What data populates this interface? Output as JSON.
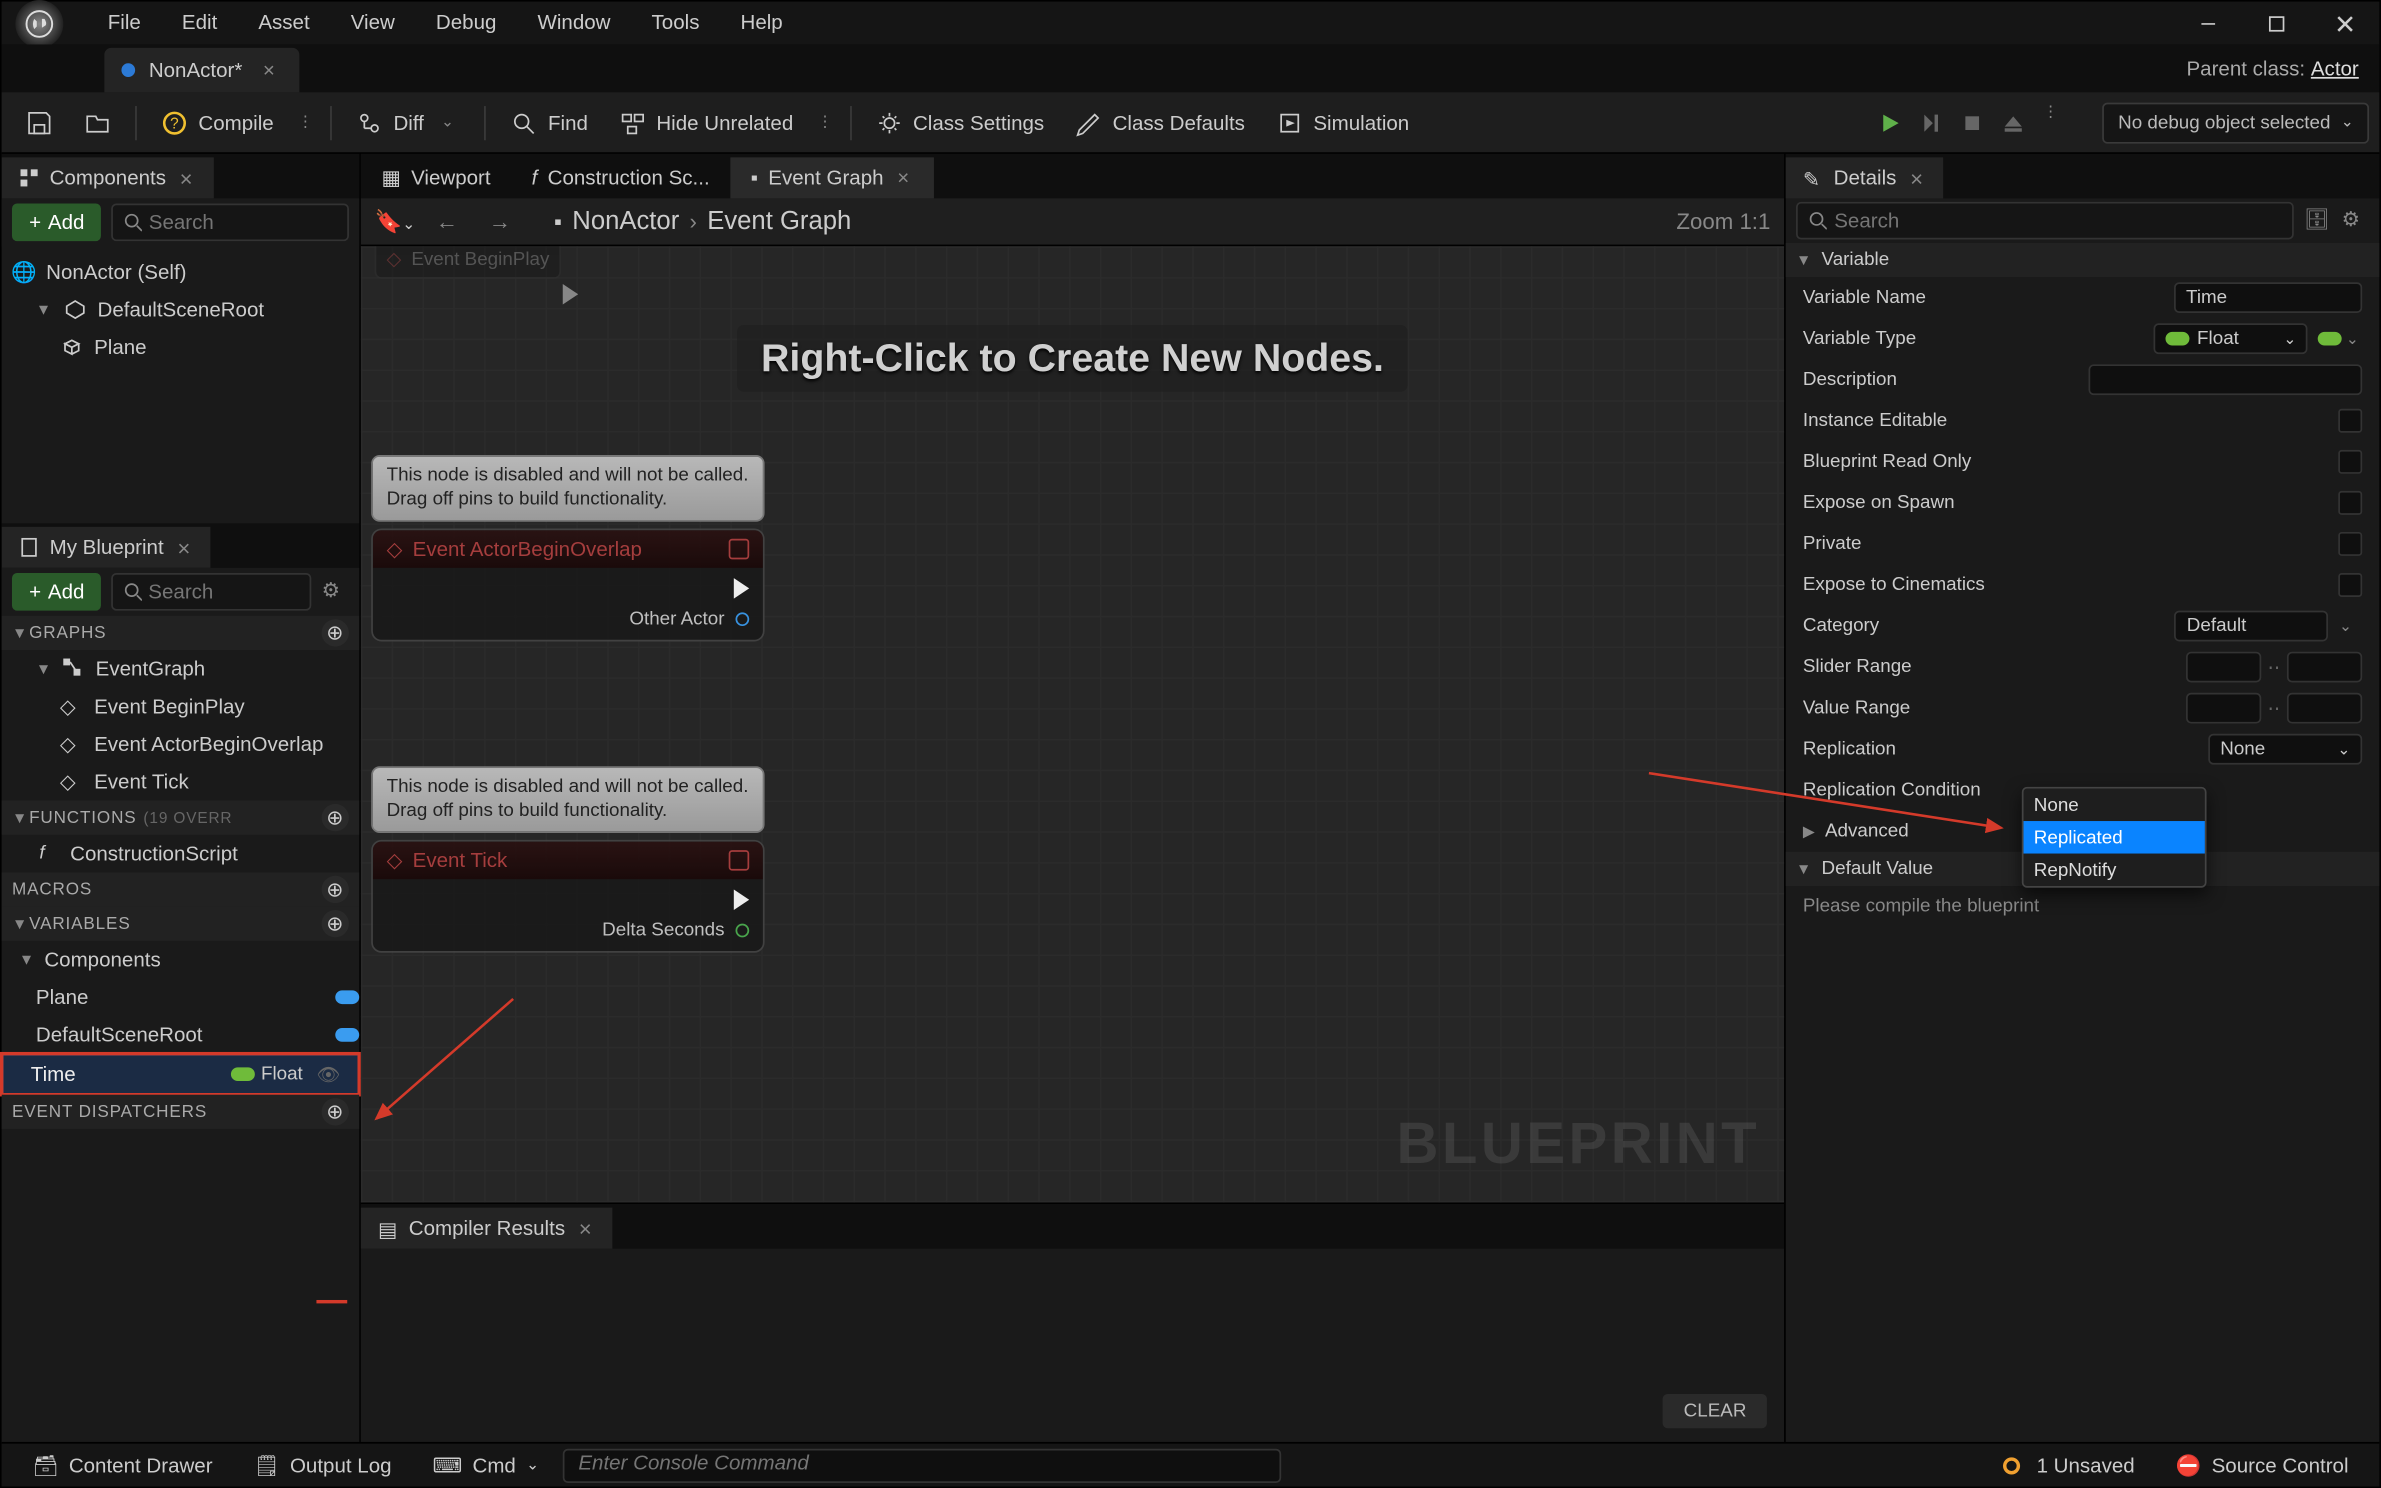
{
  "menu": [
    "File",
    "Edit",
    "Asset",
    "View",
    "Debug",
    "Window",
    "Tools",
    "Help"
  ],
  "docTab": {
    "title": "NonActor*"
  },
  "parentClass": {
    "label": "Parent class:",
    "value": "Actor"
  },
  "toolbar": {
    "compile": "Compile",
    "diff": "Diff",
    "find": "Find",
    "hideUnrelated": "Hide Unrelated",
    "classSettings": "Class Settings",
    "classDefaults": "Class Defaults",
    "simulation": "Simulation",
    "debugCombo": "No debug object selected"
  },
  "componentsPanel": {
    "tab": "Components",
    "add": "Add",
    "searchPlaceholder": "Search",
    "root": "NonActor (Self)",
    "sceneRoot": "DefaultSceneRoot",
    "plane": "Plane"
  },
  "myBlueprint": {
    "tab": "My Blueprint",
    "add": "Add",
    "searchPlaceholder": "Search",
    "graphs": {
      "title": "GRAPHS",
      "eventGraph": "EventGraph",
      "events": [
        "Event BeginPlay",
        "Event ActorBeginOverlap",
        "Event Tick"
      ]
    },
    "functions": {
      "title": "FUNCTIONS",
      "info": "(19 OVERR",
      "construction": "ConstructionScript"
    },
    "macros": {
      "title": "MACROS"
    },
    "variables": {
      "title": "VARIABLES",
      "componentsGroup": "Components",
      "plane": "Plane",
      "sceneRoot": "DefaultSceneRoot",
      "timeVar": {
        "name": "Time",
        "type": "Float"
      }
    },
    "eventDispatchers": {
      "title": "EVENT DISPATCHERS"
    }
  },
  "centerTabs": {
    "viewport": "Viewport",
    "construction": "Construction Sc...",
    "eventGraph": "Event Graph"
  },
  "breadcrumb": {
    "root": "NonActor",
    "leaf": "Event Graph",
    "zoom": "Zoom 1:1"
  },
  "graph": {
    "hint": "Right-Click to Create New Nodes.",
    "watermark": "BLUEPRINT",
    "tooltip": "This node is disabled and will not be called.\nDrag off pins to build functionality.",
    "beginPlay": "Event BeginPlay",
    "actorOverlap": {
      "title": "Event ActorBeginOverlap",
      "pin": "Other Actor"
    },
    "tick": {
      "title": "Event Tick",
      "pin": "Delta Seconds"
    }
  },
  "compiler": {
    "tab": "Compiler Results",
    "clear": "CLEAR"
  },
  "details": {
    "tab": "Details",
    "searchPlaceholder": "Search",
    "variableHdr": "Variable",
    "rows": {
      "varName": {
        "label": "Variable Name",
        "value": "Time"
      },
      "varType": {
        "label": "Variable Type",
        "value": "Float"
      },
      "description": {
        "label": "Description",
        "value": ""
      },
      "instanceEditable": {
        "label": "Instance Editable"
      },
      "bpReadOnly": {
        "label": "Blueprint Read Only"
      },
      "exposeSpawn": {
        "label": "Expose on Spawn"
      },
      "private": {
        "label": "Private"
      },
      "exposeCine": {
        "label": "Expose to Cinematics"
      },
      "category": {
        "label": "Category",
        "value": "Default"
      },
      "sliderRange": {
        "label": "Slider Range"
      },
      "valueRange": {
        "label": "Value Range"
      },
      "replication": {
        "label": "Replication",
        "value": "None"
      },
      "replicationCondition": {
        "label": "Replication Condition"
      },
      "advanced": "Advanced"
    },
    "defaultValueHdr": "Default Value",
    "compileMsg": "Please compile the blueprint",
    "dropdown": {
      "options": [
        "None",
        "Replicated",
        "RepNotify"
      ],
      "selected": "Replicated"
    }
  },
  "statusbar": {
    "contentDrawer": "Content Drawer",
    "outputLog": "Output Log",
    "cmd": "Cmd",
    "cmdPlaceholder": "Enter Console Command",
    "unsaved": "1 Unsaved",
    "sourceControl": "Source Control"
  }
}
